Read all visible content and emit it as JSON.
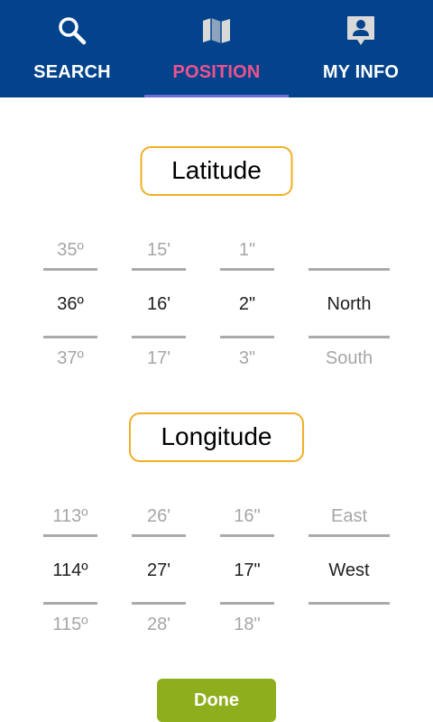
{
  "tabs": [
    {
      "label": "SEARCH",
      "icon": "search-icon"
    },
    {
      "label": "POSITION",
      "icon": "map-icon"
    },
    {
      "label": "MY INFO",
      "icon": "contact-card-icon"
    }
  ],
  "colors": {
    "topbar": "#02438c",
    "active_tab": "#f0528f",
    "tab_underline": "#6f6cd9",
    "title_border": "#f2ae24",
    "done_button": "#8fae1e"
  },
  "latitude": {
    "title": "Latitude",
    "degrees": {
      "prev": "35º",
      "current": "36º",
      "next": "37º"
    },
    "minutes": {
      "prev": "15'",
      "current": "16'",
      "next": "17'"
    },
    "seconds": {
      "prev": "1\"",
      "current": "2\"",
      "next": "3\""
    },
    "direction": {
      "prev": "",
      "current": "North",
      "next": "South"
    }
  },
  "longitude": {
    "title": "Longitude",
    "degrees": {
      "prev": "113º",
      "current": "114º",
      "next": "115º"
    },
    "minutes": {
      "prev": "26'",
      "current": "27'",
      "next": "28'"
    },
    "seconds": {
      "prev": "16\"",
      "current": "17\"",
      "next": "18\""
    },
    "direction": {
      "prev": "East",
      "current": "West",
      "next": ""
    }
  },
  "done_label": "Done"
}
